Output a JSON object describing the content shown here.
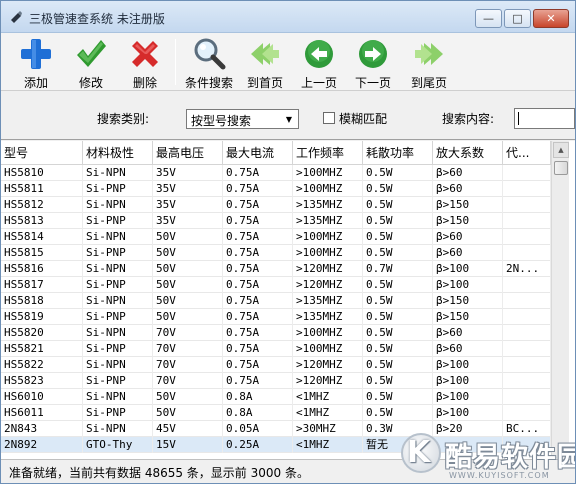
{
  "window": {
    "title": "三极管速查系统 未注册版",
    "controls": {
      "minimize": "—",
      "maximize": "□",
      "close": "✕"
    }
  },
  "toolbar": {
    "items": [
      {
        "label": "添加",
        "icon": "plus-icon"
      },
      {
        "label": "修改",
        "icon": "checkmark-icon"
      },
      {
        "label": "删除",
        "icon": "x-delete-icon"
      },
      {
        "label": "条件搜索",
        "icon": "magnifier-icon"
      },
      {
        "label": "到首页",
        "icon": "double-left-arrow-icon"
      },
      {
        "label": "上一页",
        "icon": "left-arrow-circle-icon"
      },
      {
        "label": "下一页",
        "icon": "right-arrow-circle-icon"
      },
      {
        "label": "到尾页",
        "icon": "double-right-arrow-icon"
      }
    ]
  },
  "search": {
    "category_label": "搜索类别:",
    "category_value": "按型号搜索",
    "fuzzy_label": "模糊匹配",
    "fuzzy_checked": false,
    "content_label": "搜索内容:",
    "content_value": ""
  },
  "table": {
    "columns": [
      "型号",
      "材料极性",
      "最高电压",
      "最大电流",
      "工作频率",
      "耗散功率",
      "放大系数",
      "代..."
    ],
    "rows": [
      [
        "HS5810",
        "Si-NPN",
        "35V",
        "0.75A",
        ">100MHZ",
        "0.5W",
        "β>60",
        ""
      ],
      [
        "HS5811",
        "Si-PNP",
        "35V",
        "0.75A",
        ">100MHZ",
        "0.5W",
        "β>60",
        ""
      ],
      [
        "HS5812",
        "Si-NPN",
        "35V",
        "0.75A",
        ">135MHZ",
        "0.5W",
        "β>150",
        ""
      ],
      [
        "HS5813",
        "Si-PNP",
        "35V",
        "0.75A",
        ">135MHZ",
        "0.5W",
        "β>150",
        ""
      ],
      [
        "HS5814",
        "Si-NPN",
        "50V",
        "0.75A",
        ">100MHZ",
        "0.5W",
        "β>60",
        ""
      ],
      [
        "HS5815",
        "Si-PNP",
        "50V",
        "0.75A",
        ">100MHZ",
        "0.5W",
        "β>60",
        ""
      ],
      [
        "HS5816",
        "Si-NPN",
        "50V",
        "0.75A",
        ">120MHZ",
        "0.7W",
        "β>100",
        "2N..."
      ],
      [
        "HS5817",
        "Si-PNP",
        "50V",
        "0.75A",
        ">120MHZ",
        "0.5W",
        "β>100",
        ""
      ],
      [
        "HS5818",
        "Si-NPN",
        "50V",
        "0.75A",
        ">135MHZ",
        "0.5W",
        "β>150",
        ""
      ],
      [
        "HS5819",
        "Si-PNP",
        "50V",
        "0.75A",
        ">135MHZ",
        "0.5W",
        "β>150",
        ""
      ],
      [
        "HS5820",
        "Si-NPN",
        "70V",
        "0.75A",
        ">100MHZ",
        "0.5W",
        "β>60",
        ""
      ],
      [
        "HS5821",
        "Si-PNP",
        "70V",
        "0.75A",
        ">100MHZ",
        "0.5W",
        "β>60",
        ""
      ],
      [
        "HS5822",
        "Si-NPN",
        "70V",
        "0.75A",
        ">120MHZ",
        "0.5W",
        "β>100",
        ""
      ],
      [
        "HS5823",
        "Si-PNP",
        "70V",
        "0.75A",
        ">120MHZ",
        "0.5W",
        "β>100",
        ""
      ],
      [
        "HS6010",
        "Si-NPN",
        "50V",
        "0.8A",
        "<1MHZ",
        "0.5W",
        "β>100",
        ""
      ],
      [
        "HS6011",
        "Si-PNP",
        "50V",
        "0.8A",
        "<1MHZ",
        "0.5W",
        "β>100",
        ""
      ],
      [
        "2N843",
        "Si-NPN",
        "45V",
        "0.05A",
        ">30MHZ",
        "0.3W",
        "β>20",
        "BC..."
      ],
      [
        "2N892",
        "GTO-Thy",
        "15V",
        "0.25A",
        "<1MHZ",
        "暂无",
        "",
        ""
      ]
    ],
    "selected_row": 17
  },
  "status": {
    "text": "准备就绪，当前共有数据 48655 条，显示前 3000 条。"
  },
  "watermark": {
    "logo_letter": "K",
    "text": "酷易软件园",
    "sub": "WWW.KUYISOFT.COM"
  },
  "colors": {
    "plus": "#1f6fd6",
    "check": "#2f9a2f",
    "delete": "#d62b2b",
    "arrow_light": "#8dd06a",
    "arrow_dark": "#2f9a3a"
  }
}
